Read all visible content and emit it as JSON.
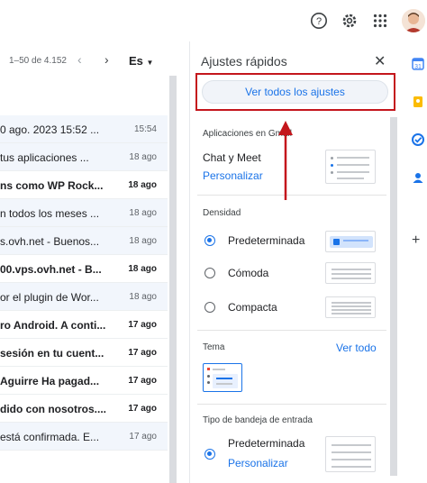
{
  "header": {
    "help_icon": "help-icon",
    "settings_icon": "gear-icon",
    "apps_icon": "apps-grid-icon"
  },
  "list": {
    "pager": "1–50 de 4.152",
    "language": "Es",
    "rows": [
      {
        "subject": "0 ago. 2023 15:52 ...",
        "date": "15:54",
        "state": "read"
      },
      {
        "subject": "tus aplicaciones ...",
        "date": "18 ago",
        "state": "read"
      },
      {
        "subject": "ns como WP Rock...",
        "date": "18 ago",
        "state": "unread"
      },
      {
        "subject": "n todos los meses ...",
        "date": "18 ago",
        "state": "read"
      },
      {
        "subject": "s.ovh.net - Buenos...",
        "date": "18 ago",
        "state": "read"
      },
      {
        "subject": "00.vps.ovh.net - B...",
        "date": "18 ago",
        "state": "unread"
      },
      {
        "subject": "or el plugin de Wor...",
        "date": "18 ago",
        "state": "read"
      },
      {
        "subject": "ro Android. A conti...",
        "date": "17 ago",
        "state": "unread"
      },
      {
        "subject": "sesión en tu cuent...",
        "date": "17 ago",
        "state": "unread"
      },
      {
        "subject": "Aguirre Ha pagad...",
        "date": "17 ago",
        "state": "unread"
      },
      {
        "subject": "dido con nosotros....",
        "date": "17 ago",
        "state": "unread"
      },
      {
        "subject": "está confirmada. E...",
        "date": "17 ago",
        "state": "read"
      }
    ]
  },
  "quick_settings": {
    "title": "Ajustes rápidos",
    "see_all": "Ver todos los ajustes",
    "apps_section": "Aplicaciones en Gmail",
    "chat_meet": "Chat y Meet",
    "customize": "Personalizar",
    "density_section": "Densidad",
    "density_options": [
      "Predeterminada",
      "Cómoda",
      "Compacta"
    ],
    "density_selected": "Predeterminada",
    "theme_section": "Tema",
    "see_all_themes": "Ver todo",
    "inbox_section": "Tipo de bandeja de entrada",
    "inbox_option": "Predeterminada",
    "inbox_customize": "Personalizar"
  },
  "colors": {
    "accent": "#1a73e8",
    "highlight_box": "#c4161c",
    "arrow": "#c4161c"
  }
}
